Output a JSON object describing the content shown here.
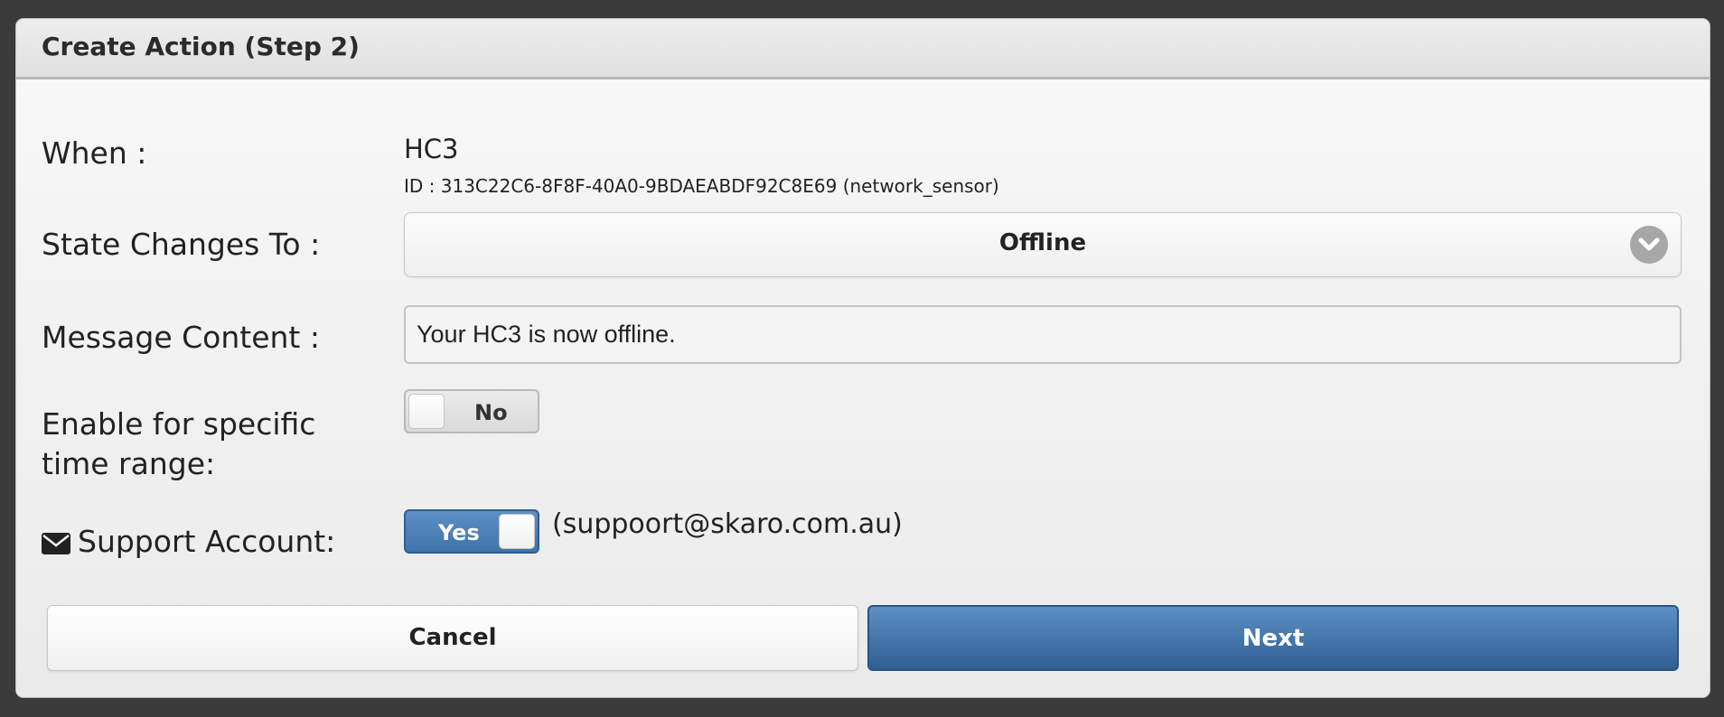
{
  "dialog": {
    "title": "Create Action (Step 2)"
  },
  "when": {
    "label": "When :",
    "device_name": "HC3",
    "device_id": "ID : 313C22C6-8F8F-40A0-9BDAEABDF92C8E69 (network_sensor)"
  },
  "state": {
    "label": "State Changes To :",
    "selected": "Offline",
    "icon": "chevron-down-icon"
  },
  "message": {
    "label": "Message Content :",
    "value": "Your HC3 is now offline."
  },
  "time_range": {
    "label": "Enable for specific time range:",
    "toggle_text": "No"
  },
  "support": {
    "icon": "envelope-icon",
    "label": "Support Account:",
    "toggle_text": "Yes",
    "email": "(suppoort@skaro.com.au)"
  },
  "buttons": {
    "cancel": "Cancel",
    "next": "Next"
  },
  "colors": {
    "accent": "#3f74ab",
    "background": "#3a3a3a"
  }
}
